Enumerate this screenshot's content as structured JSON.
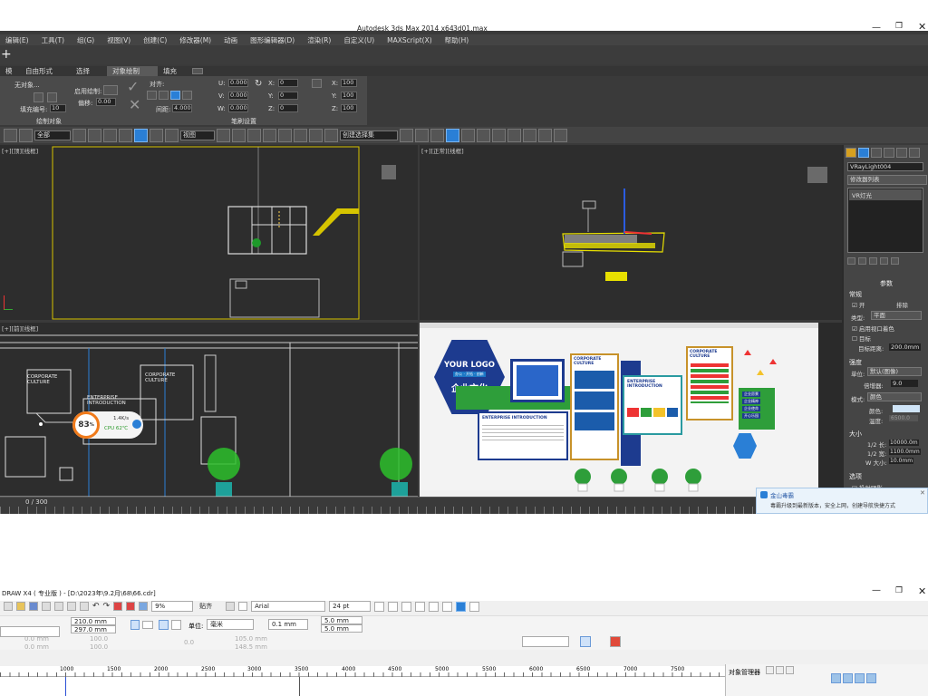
{
  "max": {
    "title": "Autodesk 3ds Max  2014 x64",
    "file": "3d01.max",
    "menu": [
      "编辑(E)",
      "工具(T)",
      "组(G)",
      "视图(V)",
      "创建(C)",
      "修改器(M)",
      "动画",
      "图形编辑器(D)",
      "渲染(R)",
      "自定义(U)",
      "MAXScript(X)",
      "帮助(H)"
    ],
    "ribbon_tabs": [
      "模",
      "自由形式",
      "选择",
      "对象绘制",
      "填充"
    ],
    "ribbon": {
      "no_object": "无对象...",
      "fill_number_label": "填充编号:",
      "fill_number": "10",
      "enable_paint_label": "启用绘制:",
      "offset_label": "偏移:",
      "offset": "0.00",
      "align_label": "对齐:",
      "spacing_label": "间距:",
      "spacing": "4.000",
      "u_val": "0.000",
      "v_val": "0.000",
      "w_val": "0.000",
      "x_val": "0",
      "y_val": "0",
      "z_val": "0",
      "sx": "100",
      "sy": "100",
      "sz": "100",
      "group1": "绘制对象",
      "group2": "笔刷设置"
    },
    "toolbar": {
      "filter": "全部",
      "view": "视图",
      "selset": "创建选择集"
    },
    "viewports": {
      "top_left": "[+][顶][线框]",
      "top_right": "[+][正常][线框]",
      "bottom_left": "[+][前][线框]",
      "ruler": "0 / 300"
    },
    "cmd": {
      "object_name": "VRayLight004",
      "modifier_list": "修改器列表",
      "stack_item": "VR灯光",
      "params": "参数",
      "general": "常规",
      "on": "开",
      "exclude": "排除",
      "type_label": "类型:",
      "type": "平面",
      "temp_color": "启用视口着色",
      "target": "目标",
      "target_dist_label": "目标距离:",
      "target_dist": "200.0mm",
      "intensity": "强度",
      "unit_label": "单位:",
      "unit": "默认(图像)",
      "multiplier_label": "倍增器:",
      "multiplier": "9.0",
      "mode_label": "模式:",
      "mode": "颜色",
      "color_label": "颜色:",
      "temp_label": "温度:",
      "temp": "6500.0",
      "size": "大小",
      "half_len_label": "1/2 长:",
      "half_len": "10000.0m",
      "half_wid_label": "1/2 宽:",
      "half_wid": "1100.0mm",
      "w_size_label": "W 大小:",
      "w_size": "10.0mm",
      "options": "选项",
      "cast_shadow": "投射阴影"
    },
    "design": {
      "logo": "YOUR LOGO",
      "tags": "办公 · 开拓 · 创新",
      "culture": "企业文化",
      "corp1": "CORPORATE CULTURE",
      "intro1": "ENTERPRISE INTRODUCTION",
      "intro2": "ENTERPRISE INTRODUCTION",
      "corp2": "CORPORATE CULTURE",
      "items": [
        "企业愿景",
        "企业精神",
        "企业使命",
        "开心乐园"
      ]
    },
    "perf": {
      "pct": "83",
      "pct_unit": "%",
      "speed": "1.4K/s",
      "cpu": "CPU 62℃"
    },
    "toast": {
      "app": "金山毒霸",
      "msg": "毒霸升级到最新版本，安全上网，创建导航快捷方式"
    }
  },
  "cdr": {
    "title": "DRAW X4 ( 专业版 ) - [D:\\2023年\\9.2月\\68\\66.cdr]",
    "zoom": "9%",
    "paste": "贴齐",
    "font": "Arial",
    "size": "24 pt",
    "width": "210.0 mm",
    "height": "297.0 mm",
    "unit_label": "单位:",
    "unit": "毫米",
    "nudge": "0.1 mm",
    "dup_x": "5.0 mm",
    "dup_y": "5.0 mm",
    "pos_x": "0.0 mm",
    "pos_y": "0.0 mm",
    "scale_x": "100.0",
    "scale_y": "100.0",
    "angle": "0.0",
    "sz_w": "105.0 mm",
    "sz_h": "148.5 mm",
    "ruler": [
      "1000",
      "1500",
      "2000",
      "2500",
      "3000",
      "3500",
      "4000",
      "4500",
      "5000",
      "5500",
      "6000",
      "6500",
      "7000",
      "7500"
    ],
    "obj_manager": "对象管理器"
  },
  "colors": {
    "accent": "#2a7fd6",
    "selection": "#d6c400",
    "toast_bg": "#eaf3fb",
    "perf_orange": "#f07a1a"
  }
}
